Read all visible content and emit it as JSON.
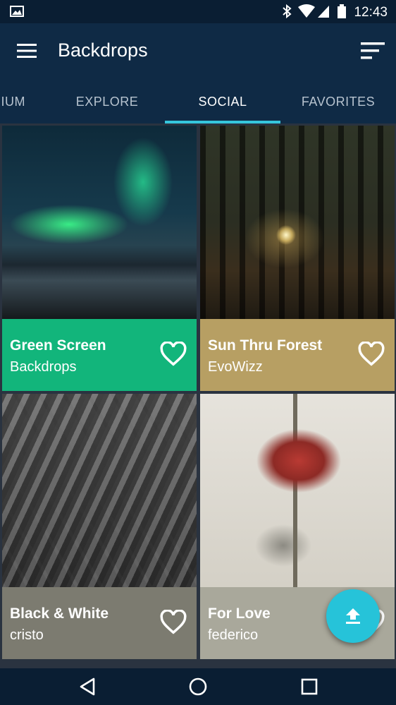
{
  "status_bar": {
    "time": "12:43",
    "icons": [
      "image-icon",
      "bluetooth-icon",
      "wifi-icon",
      "cell-signal-icon",
      "battery-icon"
    ]
  },
  "app_bar": {
    "title": "Backdrops",
    "left_icon": "menu-icon",
    "right_icon": "sort-icon"
  },
  "tabs": [
    {
      "label": "IUM"
    },
    {
      "label": "EXPLORE"
    },
    {
      "label": "SOCIAL",
      "active": true
    },
    {
      "label": "FAVORITES"
    }
  ],
  "cards": [
    {
      "name": "Green Screen",
      "author": "Backdrops",
      "color": "#12b57b"
    },
    {
      "name": "Sun Thru Forest",
      "author": "EvoWizz",
      "color": "#b79f63"
    },
    {
      "name": "Black & White",
      "author": "cristo",
      "color": "#7c7b70"
    },
    {
      "name": "For Love",
      "author": "federico",
      "color": "#a9a89b"
    }
  ],
  "fab": {
    "icon": "upload-icon"
  },
  "colors": {
    "accent": "#35c6dc",
    "app_bar": "#0f2a45",
    "fab": "#26c3d9"
  },
  "nav_bar": {
    "icons": [
      "back-icon",
      "home-icon",
      "recents-icon"
    ]
  }
}
